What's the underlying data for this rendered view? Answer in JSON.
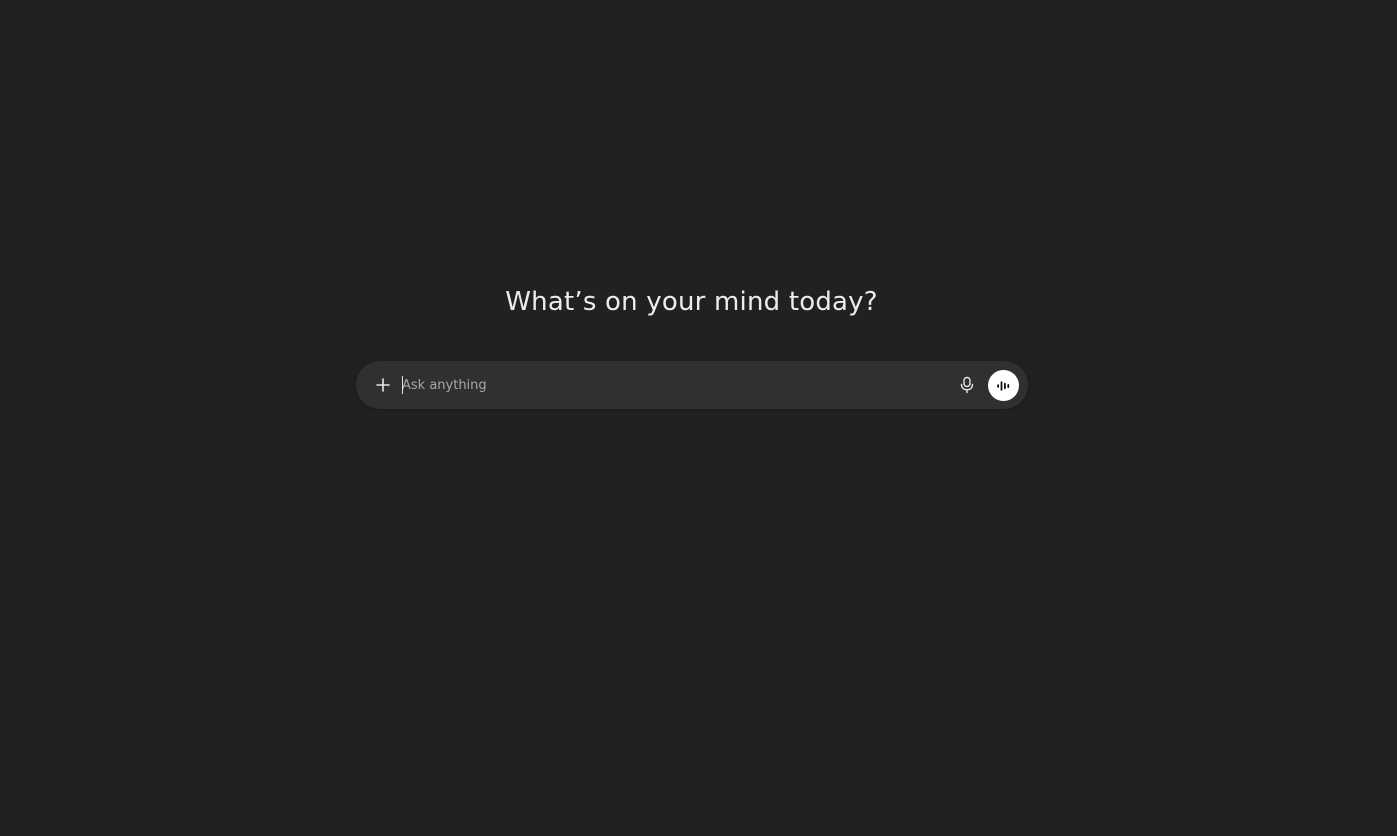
{
  "main": {
    "headline": "What’s on your mind today?"
  },
  "composer": {
    "placeholder": "Ask anything",
    "value": "",
    "icons": {
      "add": "plus-icon",
      "dictate": "microphone-icon",
      "voice_mode": "audio-waveform-icon"
    }
  },
  "colors": {
    "background": "#212121",
    "composer_background": "#303030",
    "headline_text": "#ececec",
    "placeholder_text": "#a8a8a8",
    "voice_button_background": "#ffffff"
  }
}
